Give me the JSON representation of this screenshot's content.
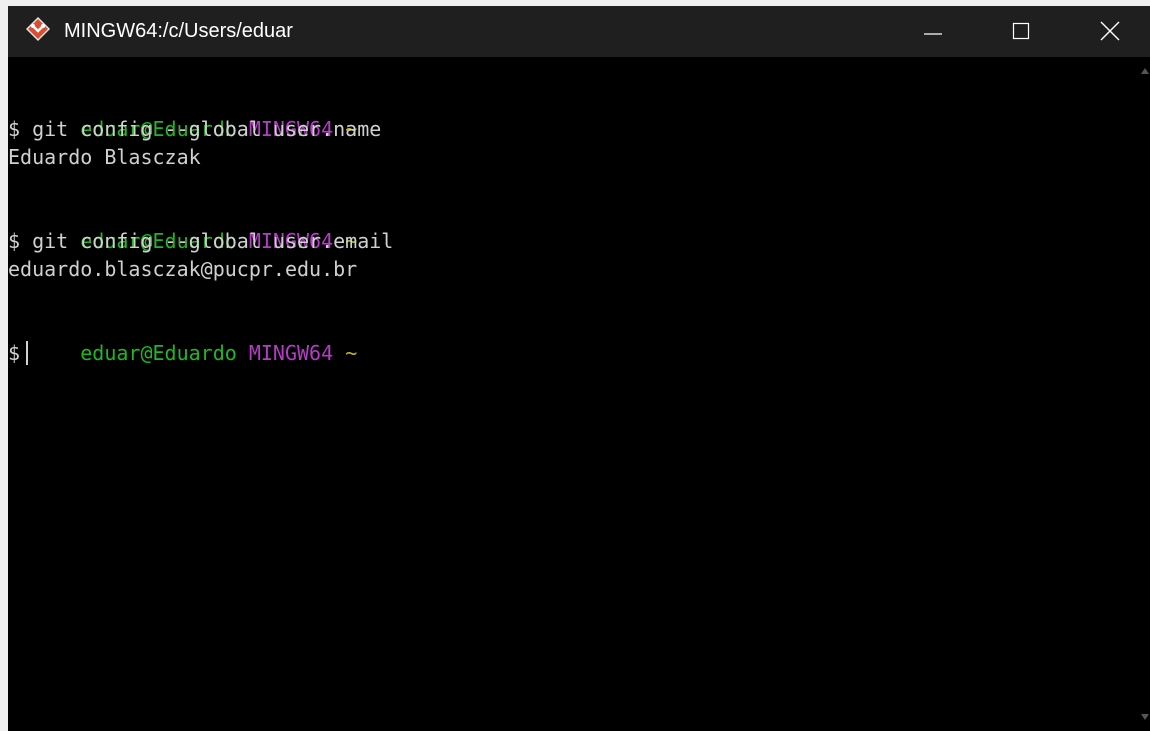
{
  "window": {
    "title": "MINGW64:/c/Users/eduar",
    "icon": "git-diamond-icon"
  },
  "colors": {
    "user_host": "#20b81e",
    "shell_name": "#b53cc7",
    "path": "#c3b629",
    "text": "#d0d0d0",
    "background": "#000000"
  },
  "terminal": {
    "prompts": [
      {
        "user": "eduar@Eduardo",
        "shell": "MINGW64",
        "path": "~",
        "command": "$ git config --global user.name",
        "output": "Eduardo Blasczak"
      },
      {
        "user": "eduar@Eduardo",
        "shell": "MINGW64",
        "path": "~",
        "command": "$ git config --global user.email",
        "output": "eduardo.blasczak@pucpr.edu.br"
      },
      {
        "user": "eduar@Eduardo",
        "shell": "MINGW64",
        "path": "~",
        "command": "$"
      }
    ]
  }
}
